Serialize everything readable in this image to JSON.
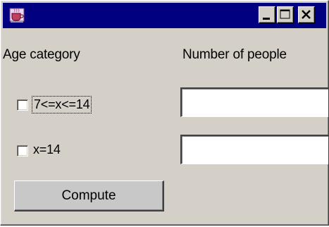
{
  "window": {
    "title": "",
    "titlebar_color": "#000080",
    "icon": "java-coffee-cup-icon",
    "controls": {
      "minimize": "minimize-icon",
      "maximize": "maximize-icon",
      "close": "close-icon"
    }
  },
  "headers": {
    "age_category": "Age category",
    "number_of_people": "Number of people"
  },
  "rows": [
    {
      "label": "7<=x<=14",
      "checked": false,
      "focused": true,
      "value": ""
    },
    {
      "label": "x=14",
      "checked": false,
      "focused": false,
      "value": ""
    }
  ],
  "compute_button": {
    "label": "Compute"
  }
}
